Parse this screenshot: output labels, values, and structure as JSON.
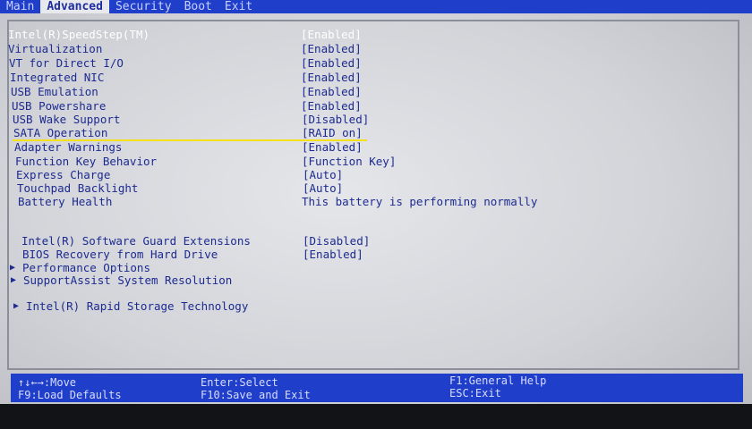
{
  "menu": {
    "tabs": [
      {
        "label": "Main",
        "active": false
      },
      {
        "label": "Advanced",
        "active": true
      },
      {
        "label": "Security",
        "active": false
      },
      {
        "label": "Boot",
        "active": false
      },
      {
        "label": "Exit",
        "active": false
      }
    ]
  },
  "settings": [
    {
      "label": "Intel(R)SpeedStep(TM)",
      "value": "[Enabled]",
      "highlighted": true
    },
    {
      "label": "Virtualization",
      "value": "[Enabled]"
    },
    {
      "label": "VT for Direct I/O",
      "value": "[Enabled]"
    },
    {
      "label": "Integrated NIC",
      "value": "[Enabled]"
    },
    {
      "label": "USB Emulation",
      "value": "[Enabled]"
    },
    {
      "label": "USB Powershare",
      "value": "[Enabled]"
    },
    {
      "label": "USB Wake Support",
      "value": "[Disabled]"
    },
    {
      "label": "SATA Operation",
      "value": "[RAID on]"
    },
    {
      "label": "Adapter Warnings",
      "value": "[Enabled]"
    },
    {
      "label": "Function Key Behavior",
      "value": "[Function Key]"
    },
    {
      "label": "Express Charge",
      "value": "[Auto]"
    },
    {
      "label": "Touchpad Backlight",
      "value": "[Auto]"
    },
    {
      "label": "Battery Health",
      "value": "This battery is performing normally"
    }
  ],
  "settings2": [
    {
      "label": "Intel(R) Software Guard Extensions",
      "value": "[Disabled]"
    },
    {
      "label": "BIOS Recovery from Hard Drive",
      "value": "[Enabled]"
    }
  ],
  "submenus": [
    {
      "label": "Performance Options"
    },
    {
      "label": "SupportAssist System Resolution"
    },
    {
      "label": "Intel(R) Rapid Storage Technology"
    }
  ],
  "help": {
    "move": "↑↓←→:Move",
    "load_defaults": "F9:Load Defaults",
    "select": "Enter:Select",
    "save_exit": "F10:Save and Exit",
    "general_help": "F1:General Help",
    "exit": "ESC:Exit"
  },
  "icons": {
    "submenu_arrow": "triangle-right-icon"
  }
}
